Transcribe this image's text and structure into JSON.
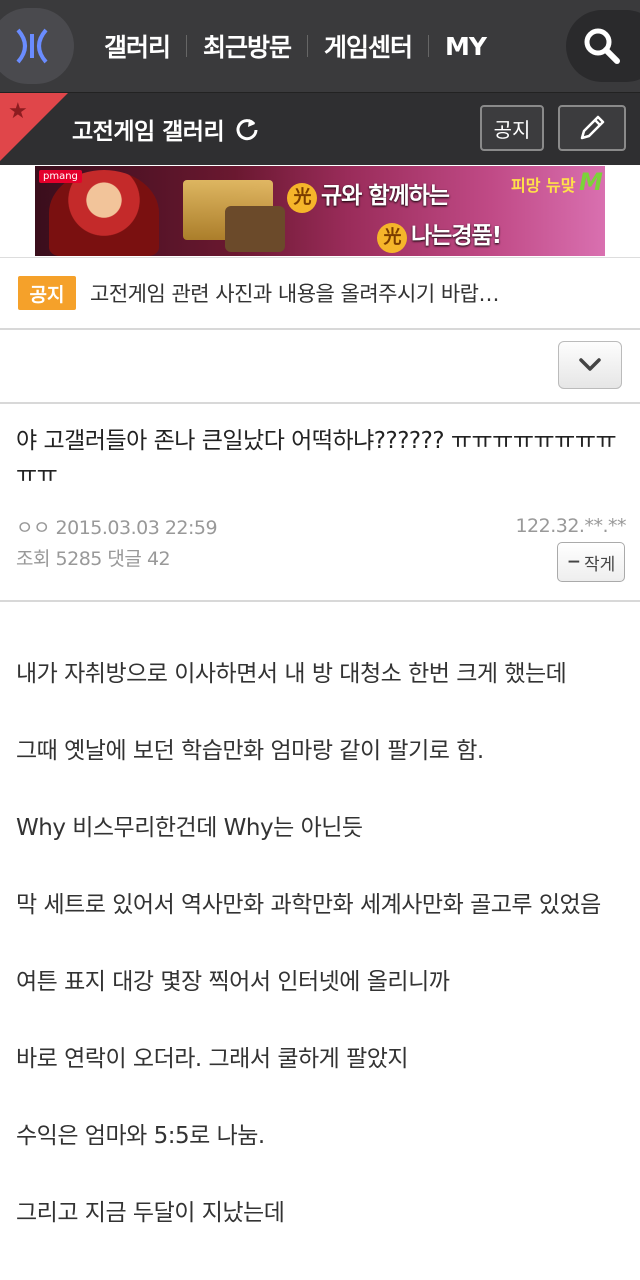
{
  "topnav": {
    "logo_icon": "dc-logo-icon",
    "items": [
      "갤러리",
      "최근방문",
      "게임센터",
      "MY"
    ],
    "search_icon": "search-icon"
  },
  "gallery_bar": {
    "title": "고전게임 갤러리",
    "notice_button": "공지",
    "write_icon": "pencil-icon",
    "accent": "#e0464a"
  },
  "banner": {
    "brand": "pmang",
    "line1_badge": "光",
    "line1_text": "규와 함께하는",
    "line2_badge": "光",
    "line2_text": "나는경품!",
    "brand2": "피망",
    "brand3": "뉴맞",
    "mark": "M"
  },
  "notice": {
    "badge": "공지",
    "text": "고전게임 관련 사진과 내용을 올려주시기 바랍…",
    "badge_color": "#f5a12a"
  },
  "post": {
    "title": "야 고갤러들아 존나 큰일났다 어떡하냐?????? ㅠㅠㅠㅠㅠㅠㅠㅠㅠㅠ",
    "author": "ㅇㅇ",
    "date": "2015.03.03 22:59",
    "ip": "122.32.**.**",
    "views_label": "조회",
    "views": "5285",
    "comments_label": "댓글",
    "comments": "42",
    "shrink_button": "작게",
    "paragraphs": [
      "내가 자취방으로 이사하면서 내 방 대청소 한번 크게 했는데",
      "그때 옛날에 보던 학습만화 엄마랑 같이 팔기로 함.",
      "Why 비스무리한건데 Why는 아닌듯",
      "막 세트로 있어서 역사만화 과학만화 세계사만화 골고루 있었음",
      "여튼 표지 대강 몇장 찍어서 인터넷에 올리니까",
      "바로 연락이 오더라. 그래서 쿨하게 팔았지",
      "수익은 엄마와 5:5로 나눔.",
      "그리고 지금 두달이 지났는데"
    ]
  }
}
